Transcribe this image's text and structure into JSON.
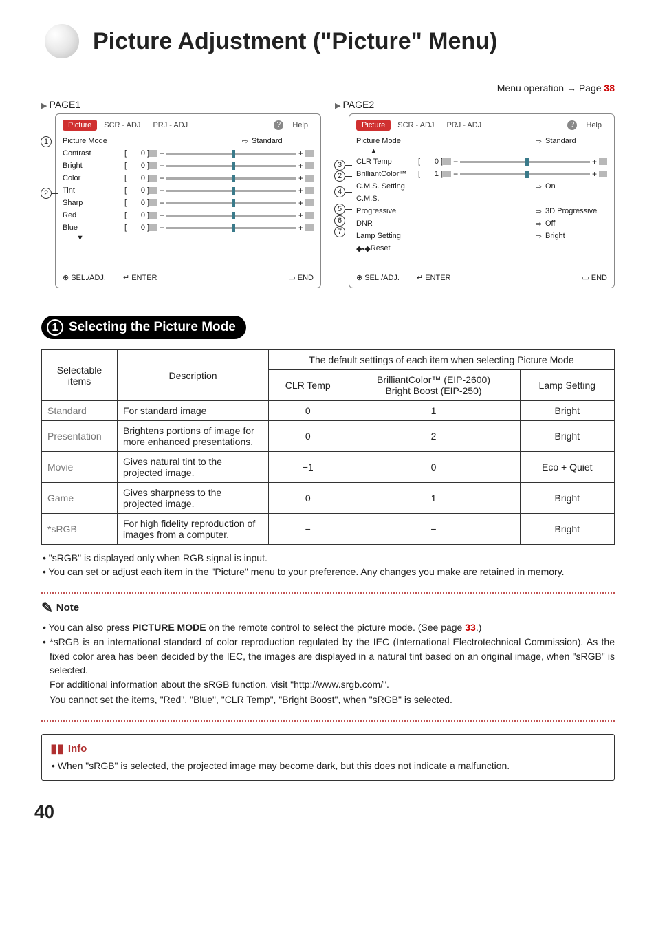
{
  "header": {
    "title": "Picture Adjustment (\"Picture\" Menu)",
    "menu_operation": "Menu operation",
    "page_ref": "Page",
    "page_num": "38"
  },
  "panel_labels": {
    "page1": "PAGE1",
    "page2": "PAGE2"
  },
  "osd_tabs": {
    "picture": "Picture",
    "scr": "SCR - ADJ",
    "prj": "PRJ - ADJ",
    "help": "Help"
  },
  "page1": {
    "picture_mode_label": "Picture Mode",
    "picture_mode_value": "Standard",
    "sliders": [
      {
        "label": "Contrast",
        "val": "0"
      },
      {
        "label": "Bright",
        "val": "0"
      },
      {
        "label": "Color",
        "val": "0"
      },
      {
        "label": "Tint",
        "val": "0"
      },
      {
        "label": "Sharp",
        "val": "0"
      },
      {
        "label": "Red",
        "val": "0"
      },
      {
        "label": "Blue",
        "val": "0"
      }
    ]
  },
  "page2": {
    "picture_mode_label": "Picture Mode",
    "picture_mode_value": "Standard",
    "clr_temp": {
      "label": "CLR Temp",
      "val": "0"
    },
    "brilliant": {
      "label": "BrilliantColor™",
      "val": "1"
    },
    "cms_setting": {
      "label": "C.M.S. Setting",
      "val": "On"
    },
    "cms": {
      "label": "C.M.S."
    },
    "progressive": {
      "label": "Progressive",
      "val": "3D Progressive"
    },
    "dnr": {
      "label": "DNR",
      "val": "Off"
    },
    "lamp": {
      "label": "Lamp Setting",
      "val": "Bright"
    },
    "reset": "Reset"
  },
  "osd_footer": {
    "sel": "SEL./ADJ.",
    "enter": "ENTER",
    "end": "END"
  },
  "callouts": {
    "n1": "1",
    "n2": "2",
    "n3": "3",
    "n4": "4",
    "n5": "5",
    "n6": "6",
    "n7": "7"
  },
  "section1": {
    "num": "1",
    "title": "Selecting the Picture Mode"
  },
  "table": {
    "hdr_selectable": "Selectable\nitems",
    "hdr_desc": "Description",
    "hdr_default": "The default settings of each item when selecting Picture Mode",
    "hdr_clr": "CLR Temp",
    "hdr_bc": "BrilliantColor™ (EIP-2600)\nBright Boost (EIP-250)",
    "hdr_lamp": "Lamp Setting",
    "rows": [
      {
        "item": "Standard",
        "desc": "For standard image",
        "clr": "0",
        "bc": "1",
        "lamp": "Bright"
      },
      {
        "item": "Presentation",
        "desc": "Brightens portions of image for more enhanced presentations.",
        "clr": "0",
        "bc": "2",
        "lamp": "Bright"
      },
      {
        "item": "Movie",
        "desc": "Gives natural tint to the projected image.",
        "clr": "−1",
        "bc": "0",
        "lamp": "Eco + Quiet"
      },
      {
        "item": "Game",
        "desc": "Gives sharpness to the projected image.",
        "clr": "0",
        "bc": "1",
        "lamp": "Bright"
      },
      {
        "item": "*sRGB",
        "desc": "For high fidelity reproduction of images from a computer.",
        "clr": "−",
        "bc": "−",
        "lamp": "Bright"
      }
    ]
  },
  "bullets_after_table": {
    "b1": "• \"sRGB\" is displayed only when RGB signal is input.",
    "b2": "• You can set or adjust each item in the \"Picture\" menu to your preference. Any changes you make are retained in memory."
  },
  "note": {
    "heading": "Note",
    "l1_a": "• You can also press ",
    "l1_b": "PICTURE MODE",
    "l1_c": " on the remote control to select the picture mode. (See page ",
    "l1_page": "33",
    "l1_d": ".)",
    "l2": "• *sRGB is an international standard of color reproduction regulated by the IEC (International Electrotechnical Commission). As the fixed color area has been decided by the IEC, the images are displayed in a natural tint based on an original image, when \"sRGB\" is selected.",
    "l3": "For additional information about the sRGB function, visit \"http://www.srgb.com/\".",
    "l4": "You cannot set the items, \"Red\", \"Blue\", \"CLR Temp\", \"Bright Boost\", when \"sRGB\" is selected."
  },
  "info": {
    "heading": "Info",
    "body": "• When \"sRGB\" is selected, the projected image may become dark, but this does not indicate a malfunction."
  },
  "page_number": "40"
}
